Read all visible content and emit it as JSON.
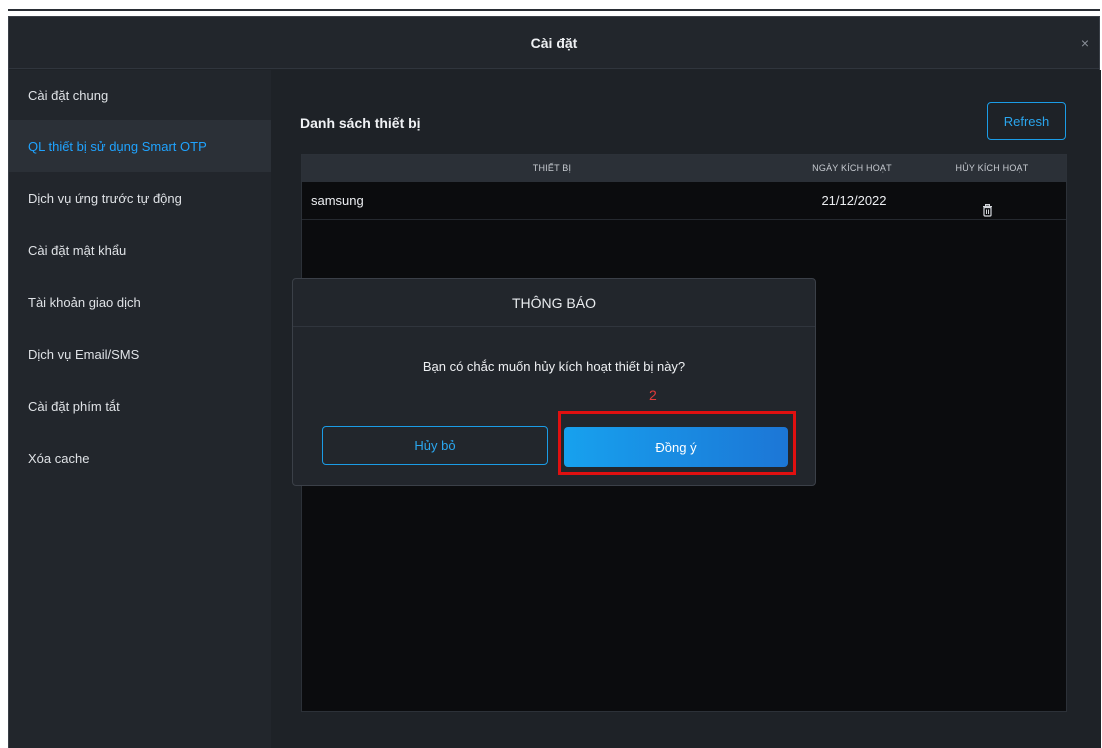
{
  "window": {
    "title": "Cài đặt",
    "close_glyph": "×"
  },
  "sidebar": {
    "items": [
      {
        "label": "Cài đặt chung",
        "active": false
      },
      {
        "label": "QL thiết bị sử dụng Smart OTP",
        "active": true
      },
      {
        "label": "Dịch vụ ứng trước tự động",
        "active": false
      },
      {
        "label": "Cài đặt mật khẩu",
        "active": false
      },
      {
        "label": "Tài khoản giao dịch",
        "active": false
      },
      {
        "label": "Dịch vụ Email/SMS",
        "active": false
      },
      {
        "label": "Cài đặt phím tắt",
        "active": false
      },
      {
        "label": "Xóa cache",
        "active": false
      }
    ]
  },
  "main": {
    "section_title": "Danh sách thiết bị",
    "refresh_label": "Refresh",
    "table": {
      "headers": {
        "device": "THIẾT BỊ",
        "activation_date": "NGÀY KÍCH HOẠT",
        "deactivate": "HỦY KÍCH HOẠT"
      },
      "rows": [
        {
          "device": "samsung",
          "activation_date": "21/12/2022",
          "action_icon": "trash-icon"
        }
      ]
    }
  },
  "dialog": {
    "title": "THÔNG BÁO",
    "message": "Bạn có chắc muốn hủy kích hoạt thiết bị này?",
    "step_marker": "2",
    "cancel_label": "Hủy bỏ",
    "confirm_label": "Đồng ý"
  },
  "colors": {
    "accent": "#1fa3ff",
    "button_gradient_start": "#17a1ee",
    "button_gradient_end": "#1c76d6",
    "highlight_red": "#e01010",
    "background": "#1e2227",
    "panel": "#22262c"
  }
}
